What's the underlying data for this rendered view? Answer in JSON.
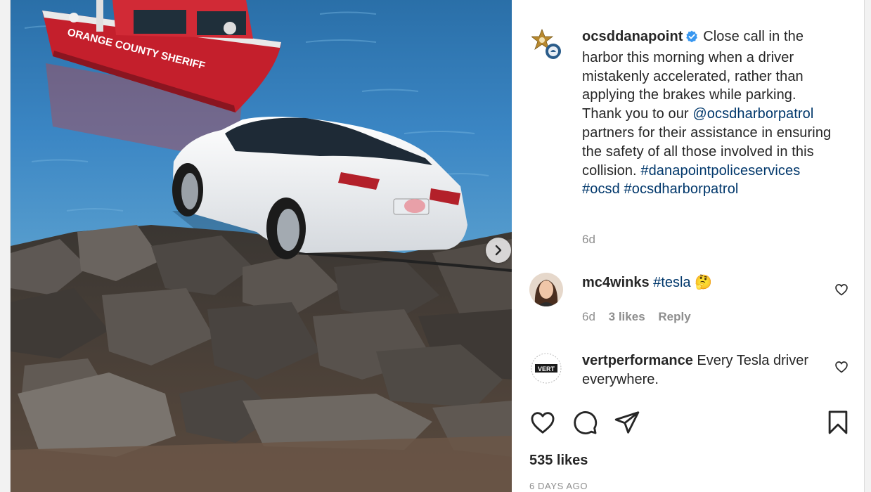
{
  "post": {
    "author": "ocsddanapoint",
    "caption_parts": [
      "Close call in the harbor this morning when a driver mistakenly accelerated, rather than applying the brakes while parking. Thank you to our ",
      "@ocsdharborpatrol",
      " partners for their assistance in ensuring the safety of all those involved in this collision. ",
      "#danapointpoliceservices",
      " ",
      "#ocsd",
      " ",
      "#ocsdharborpatrol"
    ],
    "time": "6d",
    "likes": "535 likes",
    "time_ago": "6 DAYS AGO",
    "media_boat_text": "ORANGE COUNTY SHERIFF"
  },
  "comments": [
    {
      "username": "mc4winks",
      "text": "#tesla",
      "emoji": "🤔",
      "time": "6d",
      "likes": "3 likes",
      "reply": "Reply"
    },
    {
      "username": "vertperformance",
      "text": "Every Tesla driver everywhere.",
      "avatar_text": "VERT"
    }
  ],
  "colors": {
    "verified": "#3897f0",
    "link": "#00376b",
    "muted": "#8e8e8e",
    "water": "#3b86c4",
    "boat": "#c41f2c"
  },
  "icons": {
    "next": "chevron-right-icon",
    "like": "heart-icon",
    "comment": "comment-bubble-icon",
    "share": "paper-plane-icon",
    "save": "bookmark-icon"
  }
}
